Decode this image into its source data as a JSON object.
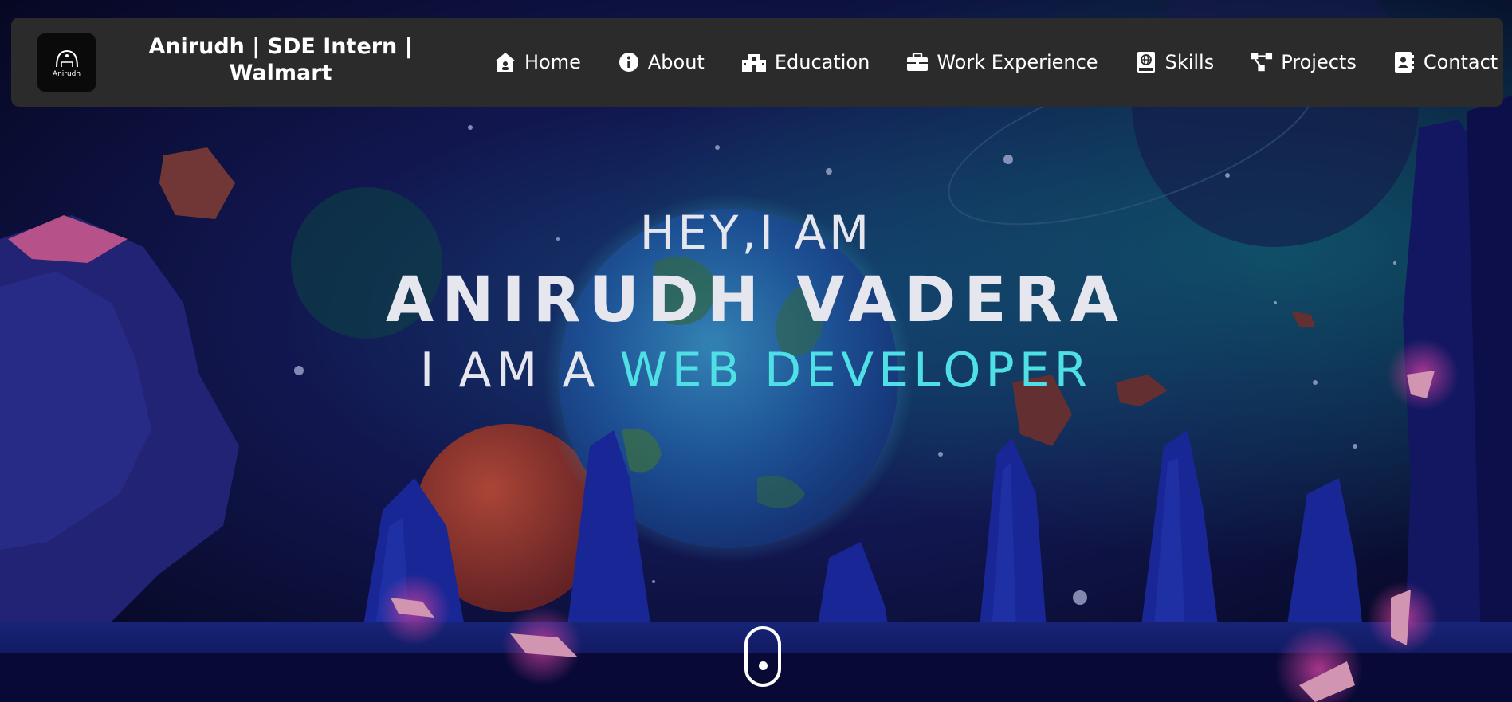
{
  "brand": {
    "logo_text": "Anirudh",
    "title": "Anirudh | SDE Intern | Walmart"
  },
  "nav": [
    {
      "label": "Home",
      "icon": "home-icon"
    },
    {
      "label": "About",
      "icon": "info-icon"
    },
    {
      "label": "Education",
      "icon": "building-icon"
    },
    {
      "label": "Work Experience",
      "icon": "briefcase-icon"
    },
    {
      "label": "Skills",
      "icon": "book-icon"
    },
    {
      "label": "Projects",
      "icon": "project-diagram-icon"
    },
    {
      "label": "Contact",
      "icon": "address-book-icon"
    }
  ],
  "hero": {
    "greeting": "HEY,I AM",
    "name": "ANIRUDH VADERA",
    "role_prefix": "I AM A",
    "role": "WEB DEVELOPER"
  },
  "colors": {
    "navbar_bg": "#2b2b2b",
    "accent": "#4fe0e6",
    "text": "#ffffff"
  }
}
